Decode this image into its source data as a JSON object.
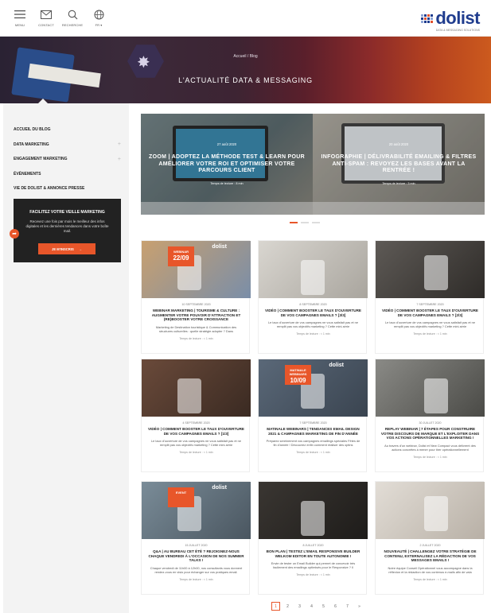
{
  "header": {
    "nav": [
      {
        "label": "MENU",
        "icon": "hamburger-icon"
      },
      {
        "label": "CONTACT",
        "icon": "mail-icon"
      },
      {
        "label": "RECHERCHE",
        "icon": "search-icon"
      },
      {
        "label": "FR ▾",
        "icon": "globe-icon"
      }
    ],
    "logo_text": "dolist",
    "logo_sub": "DATA & MESSAGING SOLUTIONS"
  },
  "hero": {
    "breadcrumb": "Accueil / Blog",
    "title": "L'ACTUALITÉ DATA & MESSAGING"
  },
  "sidebar": {
    "items": [
      {
        "label": "ACCUEIL DU BLOG",
        "expandable": false
      },
      {
        "label": "DATA MARKETING",
        "expandable": true
      },
      {
        "label": "ENGAGEMENT MARKETING",
        "expandable": true
      },
      {
        "label": "ÉVÈNEMENTS",
        "expandable": false
      },
      {
        "label": "VIE DE DOLIST & ANNONCE PRESSE",
        "expandable": false
      }
    ],
    "plus": "+",
    "newsletter": {
      "title": "FACILITEZ VOTRE VEILLE MARKETING",
      "desc": "Recevez une fois par mois le meilleur des infos digitales et les dernières tendances dans votre boîte mail.",
      "button": "JE M'INSCRIS",
      "arrow": "→"
    }
  },
  "slider": {
    "slides": [
      {
        "date": "27 août 2020",
        "title": "ZOOM | ADOPTEZ LA MÉTHODE TEST & LEARN POUR AMÉLIORER VOTRE ROI ET OPTIMISER VOTRE PARCOURS CLIENT",
        "read": "Temps de lecture : 8 min"
      },
      {
        "date": "20 août 2020",
        "title": "INFOGRAPHIE | DÉLIVRABILITÉ EMAILING & FILTRES ANTI-SPAM : REVOYEZ LES BASES AVANT LA RENTRÉE !",
        "read": "Temps de lecture : 3 min"
      }
    ]
  },
  "articles": [
    {
      "date": "10 SEPTEMBRE 2020",
      "title": "WEBINAR MARKETING | TOURISME & CULTURE : AUGMENTER VOTRE POUVOIR D'ATTRACTION ET (RE)BOOSTER VOTRE CROISSANCE",
      "excerpt": "Marketing de Destination touristique & Communication des structures culturelles : quelle stratégie adopter ? Dans",
      "read": "Temps de lecture : < 1 min",
      "tag_a": "WEBINAR",
      "tag_b": "22/09",
      "brand": "dolist",
      "bg": [
        "#c8a070",
        "#7a8ea8"
      ]
    },
    {
      "date": "8 SEPTEMBRE 2020",
      "title": "VIDÉO | COMMENT BOOSTER LE TAUX D'OUVERTURE DE VOS CAMPAGNES EMAILS ? [3/3]",
      "excerpt": "Le taux d'ouverture de vos campagnes ne vous satisfait pas et ne remplit pas vos objectifs marketing ? Cette mini-série",
      "read": "Temps de lecture : < 1 min",
      "bg": [
        "#d9d6d0",
        "#a9a59e"
      ]
    },
    {
      "date": "7 SEPTEMBRE 2020",
      "title": "VIDÉO | COMMENT BOOSTER LE TAUX D'OUVERTURE DE VOS CAMPAGNES EMAILS ? [2/3]",
      "excerpt": "Le taux d'ouverture de vos campagnes ne vous satisfait pas et ne remplit pas vos objectifs marketing ? Cette mini-série",
      "read": "Temps de lecture : < 1 min",
      "bg": [
        "#5e5a56",
        "#2e2b28"
      ]
    },
    {
      "date": "4 SEPTEMBRE 2020",
      "title": "VIDÉO | COMMENT BOOSTER LE TAUX D'OUVERTURE DE VOS CAMPAGNES EMAILS ? [1/3]",
      "excerpt": "Le taux d'ouverture de vos campagnes ne vous satisfait pas et ne remplit pas vos objectifs marketing ? Cette mini-série",
      "read": "Temps de lecture : < 1 min",
      "bg": [
        "#6a4a3a",
        "#3a2a22"
      ]
    },
    {
      "date": "7 SEPTEMBRE 2020",
      "title": "MATINALE WEBINARS | TENDANCES EMAIL DESIGN 2021 & CAMPAGNES MARKETING DE FIN D'ANNÉE",
      "excerpt": "Préparez sereinement vos campagnes emailings spéciales Fêtes de fin d'année ! Découvrez enfin comment réaliser des optins",
      "read": "Temps de lecture : < 1 min",
      "tag_a": "MATINALE WEBINARS",
      "tag_b": "10/09",
      "brand": "dolist",
      "bg": [
        "#5a6878",
        "#3a4450"
      ]
    },
    {
      "date": "30 JUILLET 2020",
      "title": "REPLAY WEBINAR | 7 ÉTAPES POUR CONSTRUIRE VOTRE DISCOURS DE MARQUE ET L'EXPLOITER DANS VOS ACTIONS OPÉRATIONNELLES MARKETING !",
      "excerpt": "Au travers d'un webinar, Dolist et New Compact vous délivrent des actions concrètes à mener pour tirer opérationnellement",
      "read": "Temps de lecture : < 1 min",
      "bg": [
        "#8a8a86",
        "#4a4a46"
      ]
    },
    {
      "date": "15 JUILLET 2020",
      "title": "Q&A | AU BUREAU CET ÉTÉ ? REJOIGNEZ-NOUS CHAQUE VENDREDI À L'OCCASION DE NOS SUMMER TALKS !",
      "excerpt": "Chaque vendredi de 11h00 à 12h00, nos consultants vous donnent rendez-vous en visio pour échanger sur vos pratiques email.",
      "read": "Temps de lecture : < 1 min",
      "tag_a": "EVENT",
      "tag_b": "",
      "brand": "dolist",
      "bg": [
        "#7a8c98",
        "#4a5660"
      ]
    },
    {
      "date": "8 JUILLET 2020",
      "title": "BON PLAN | TESTEZ L'EMAIL RESPONSIVE BUILDER WELKOM EDITOR EN TOUTE AUTONOMIE !",
      "excerpt": "Envie de tester un Email Builder qui permet de concevoir très facilement des emailings optimisés pour le Responsive ? Il",
      "read": "Temps de lecture : < 1 min",
      "bg": [
        "#3a3632",
        "#1e1c1a"
      ]
    },
    {
      "date": "2 JUILLET 2020",
      "title": "NOUVEAUTÉ | CHALLENGEZ VOTRE STRATÉGIE DE CONTENU, EXTERNALISEZ LA RÉDACTION DE VOS MESSAGES EMAILS !",
      "excerpt": "Notre équipe Conseil Opérationnel vous accompagne dans la réflexion et la rédaction de vos contenus e-mails afin de vala",
      "read": "Temps de lecture : < 1 min",
      "bg": [
        "#e2ddd6",
        "#b8b0a6"
      ]
    }
  ],
  "pagination": [
    "1",
    "2",
    "3",
    "4",
    "5",
    "6",
    "7",
    "»"
  ],
  "colors": {
    "accent": "#e8562a",
    "brand": "#1f3c8e"
  }
}
